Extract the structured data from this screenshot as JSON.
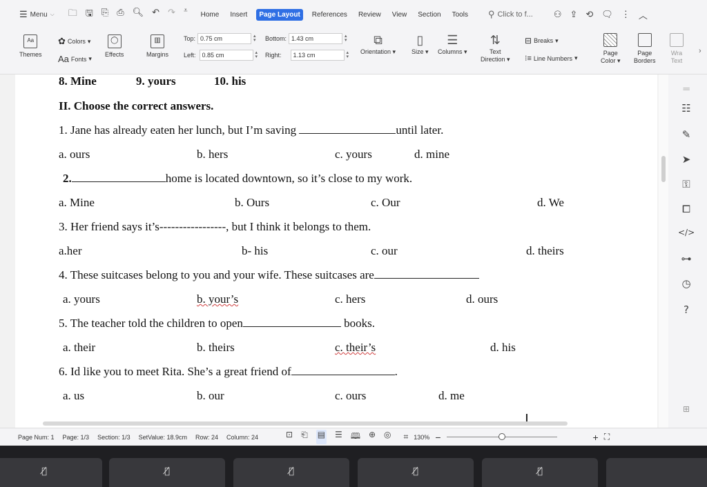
{
  "menubar": {
    "menu_label": "Menu",
    "tabs": [
      "Home",
      "Insert",
      "Page Layout",
      "References",
      "Review",
      "View",
      "Section",
      "Tools"
    ],
    "active_tab": "Page Layout",
    "search_placeholder": "Click to f...",
    "accent": "#2f6fe4"
  },
  "ribbon": {
    "themes": "Themes",
    "colors": "Colors",
    "fonts": "Fonts",
    "effects": "Effects",
    "margins": "Margins",
    "top_label": "Top:",
    "top_value": "0.75 cm",
    "left_label": "Left:",
    "left_value": "0.85 cm",
    "bottom_label": "Bottom:",
    "bottom_value": "1.43 cm",
    "right_label": "Right:",
    "right_value": "1.13 cm",
    "orientation": "Orientation",
    "size": "Size",
    "columns": "Columns",
    "text_direction_1": "Text",
    "text_direction_2": "Direction",
    "breaks": "Breaks",
    "line_numbers": "Line Numbers",
    "page_color_1": "Page",
    "page_color_2": "Color",
    "page_borders_1": "Page",
    "page_borders_2": "Borders",
    "wrap_1": "Wra",
    "wrap_2": "Text"
  },
  "document": {
    "prev_line": {
      "a": "8.  Mine",
      "b": "9. yours",
      "c": "10. his"
    },
    "section_title": "II. Choose the correct answers.",
    "questions": [
      {
        "pre": "1. Jane has already eaten her lunch, but I’m saving ",
        "post": "until later.",
        "options": [
          "a. ours",
          "b. hers",
          "c. yours",
          "d. mine"
        ]
      },
      {
        "pre": "2.",
        "post": "home is located downtown, so it’s close to my work.",
        "options": [
          "a. Mine",
          "b. Ours",
          "c.  Our",
          "d. We"
        ]
      },
      {
        "pre": "3. Her friend says it’s-----------------, but I think it belongs to them.",
        "post": "",
        "options": [
          "a.her",
          "b- his",
          "c.  our",
          "d. theirs"
        ]
      },
      {
        "pre": "4. These suitcases belong to you and your wife. These suitcases are",
        "post": "",
        "options": [
          "a. yours",
          "b. your’s",
          "c. hers",
          "d. ours"
        ]
      },
      {
        "pre": "5. The teacher told the children to open",
        "post": " books.",
        "options": [
          "a. their",
          "b. theirs",
          "c. their’s",
          "d. his"
        ]
      },
      {
        "pre": "6. Id like you to meet Rita. She’s a great friend of",
        "post": ".",
        "options": [
          "a. us",
          "b. our",
          "c. ours",
          "d. me"
        ]
      }
    ]
  },
  "statusbar": {
    "page_num": "Page Num: 1",
    "page": "Page: 1/3",
    "section": "Section: 1/3",
    "setvalue": "SetValue: 18.9cm",
    "row": "Row: 24",
    "column": "Column: 24",
    "zoom": "130%",
    "zoom_level_fraction": 0.5
  }
}
